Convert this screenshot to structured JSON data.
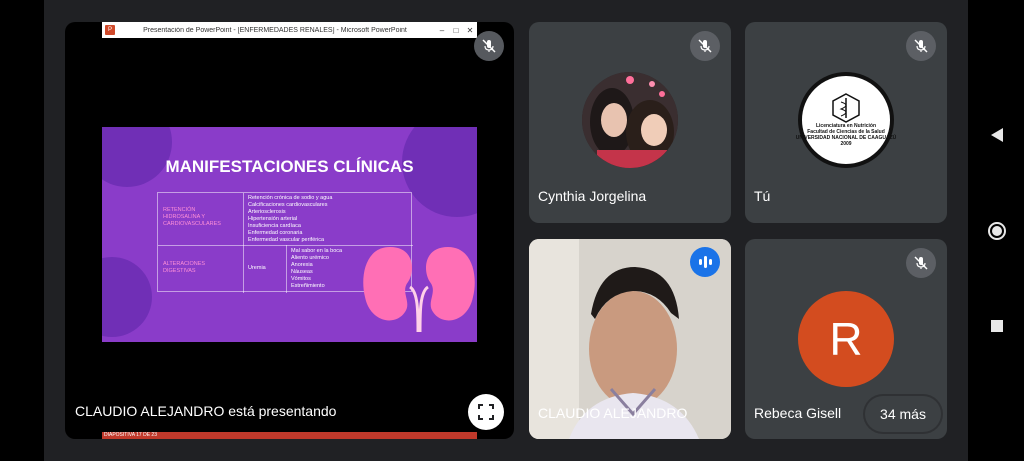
{
  "presentation": {
    "window_title": "Presentación de PowerPoint - [ENFERMEDADES RENALES] - Microsoft PowerPoint",
    "slide_title": "MANIFESTACIONES CLÍNICAS",
    "table": {
      "row1_header": "RETENCIÓN\nHIDROSALINA Y\nCARDIOVASCULARES",
      "row1_items": "Retención crónica de sodio y agua\nCalcificaciones cardiovasculares\nArteriosclerosis\nHipertensión arterial\nInsuficiencia cardíaca\nEnfermedad coronaria\nEnfermedad vascular periférica",
      "row2_header": "ALTERACIONES\nDIGESTIVAS",
      "row2_middle": "Uremia",
      "row2_items": "Mal sabor en la boca\nAliento urémico\nAnorexia\nNáuseas\nVómitos\nEstreñimiento"
    },
    "status_bar": "DIAPOSITIVA 17 DE 23",
    "presenter_label": "CLAUDIO ALEJANDRO está presentando"
  },
  "participants": {
    "cynthia": {
      "name": "Cynthia Jorgelina"
    },
    "tu": {
      "name": "Tú",
      "seal_text": "Licenciatura en Nutrición\nFacultad de Ciencias de la Salud\nUNIVERSIDAD NACIONAL DE CAAGUAZÚ\n2009"
    },
    "claudio": {
      "name": "CLAUDIO ALEJANDRO"
    },
    "rebeca": {
      "name": "Rebeca Gisell",
      "initial": "R"
    }
  },
  "overflow": {
    "more_label": "34 más"
  },
  "colors": {
    "background": "#202124",
    "tile": "#3c4043",
    "slide_purple": "#8a3cc9",
    "avatar_orange": "#d34c1f",
    "speaking_blue": "#1a73e8"
  }
}
